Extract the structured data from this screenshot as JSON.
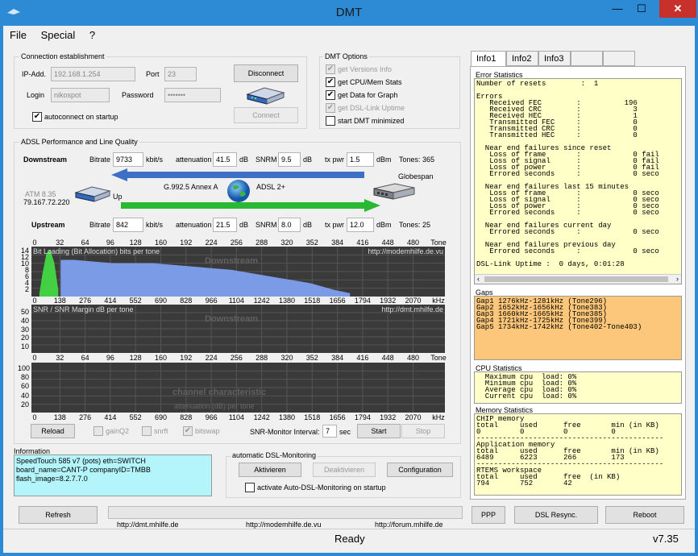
{
  "window": {
    "title": "DMT",
    "minimize": "—",
    "maximize": "☐",
    "close": "✕"
  },
  "menu": [
    "File",
    "Special",
    "?"
  ],
  "connection": {
    "group_label": "Connection establishment",
    "ip_label": "IP-Add.",
    "ip_value": "192.168.1.254",
    "port_label": "Port",
    "port_value": "23",
    "login_label": "Login",
    "login_value": "nikospot",
    "password_label": "Password",
    "password_value": "•••••••",
    "autoconnect_label": "autoconnect on startup",
    "disconnect_label": "Disconnect",
    "connect_label": "Connect"
  },
  "dmt_options": {
    "group_label": "DMT Options",
    "items": [
      {
        "label": "get Versions Info",
        "checked": true,
        "enabled": false
      },
      {
        "label": "get CPU/Mem Stats",
        "checked": true,
        "enabled": true
      },
      {
        "label": "get Data for Graph",
        "checked": true,
        "enabled": true
      },
      {
        "label": "get DSL-Link Uptime",
        "checked": true,
        "enabled": false
      },
      {
        "label": "start DMT minimized",
        "checked": false,
        "enabled": true
      }
    ]
  },
  "adsl": {
    "group_label": "ADSL Performance and Line Quality",
    "downstream": {
      "label": "Downstream",
      "bitrate_label": "Bitrate",
      "bitrate": "9733",
      "bitrate_unit": "kbit/s",
      "att_label": "attenuation",
      "att": "41.5",
      "att_unit": "dB",
      "snrm_label": "SNRM",
      "snrm": "9.5",
      "snrm_unit": "dB",
      "txpwr_label": "tx pwr",
      "txpwr": "1.5",
      "txpwr_unit": "dBm",
      "tones": "Tones: 365"
    },
    "upstream": {
      "label": "Upstream",
      "bitrate_label": "Bitrate",
      "bitrate": "842",
      "bitrate_unit": "kbit/s",
      "att_label": "attenuation",
      "att": "21.5",
      "att_unit": "dB",
      "snrm_label": "SNRM",
      "snrm": "8.0",
      "snrm_unit": "dB",
      "txpwr_label": "tx pwr",
      "txpwr": "12.0",
      "txpwr_unit": "dBm",
      "tones": "Tones: 25"
    },
    "atm": "ATM 8.35",
    "ext_ip": "79.167.72.220",
    "up_label": "Up",
    "mode": "G.992.5 Annex A",
    "adsl_type": "ADSL 2+",
    "dslam": "Globespan"
  },
  "charts": {
    "top_axis": [
      "0",
      "32",
      "64",
      "96",
      "128",
      "160",
      "192",
      "224",
      "256",
      "288",
      "320",
      "352",
      "384",
      "416",
      "448",
      "480",
      "Tone"
    ],
    "bottom_axis": [
      "0",
      "138",
      "276",
      "414",
      "552",
      "690",
      "828",
      "966",
      "1104",
      "1242",
      "1380",
      "1518",
      "1656",
      "1794",
      "1932",
      "2070",
      "kHz"
    ],
    "bitload": {
      "title": "Bit Loading (Bit Allocation)   bits per tone",
      "url": "http://modemhilfe.de.vu",
      "wm": "Downstream",
      "yticks": [
        "14",
        "12",
        "10",
        "8",
        "6",
        "4",
        "2"
      ]
    },
    "snr": {
      "title": "SNR / SNR Margin  dB per tone",
      "url": "http://dmt.mhilfe.de",
      "wm": "Downstream",
      "yticks": [
        "50",
        "40",
        "30",
        "20",
        "10"
      ]
    },
    "chan": {
      "wm1": "channel characteristic",
      "wm2": "attenuation (dB) per tone",
      "yticks": [
        "100",
        "80",
        "60",
        "40",
        "20"
      ]
    }
  },
  "chart_data": [
    {
      "type": "area",
      "title": "Bit Loading (Bit Allocation)   bits per tone",
      "xlabel": "Tone",
      "ylim": [
        0,
        15
      ],
      "series": [
        {
          "name": "Up",
          "x": [
            6,
            10,
            15,
            20,
            25,
            30
          ],
          "values": [
            1,
            7,
            13,
            14,
            10,
            2
          ]
        },
        {
          "name": "Downstream",
          "x": [
            33,
            50,
            100,
            150,
            200,
            250,
            300,
            350,
            380,
            400
          ],
          "values": [
            11,
            11,
            10,
            10,
            9,
            8,
            6,
            4,
            2,
            1
          ]
        }
      ]
    },
    {
      "type": "area",
      "title": "SNR / SNR Margin  dB per tone",
      "ylim": [
        0,
        55
      ],
      "series": []
    },
    {
      "type": "area",
      "title": "channel characteristic",
      "ylim": [
        0,
        110
      ],
      "series": []
    }
  ],
  "controls": {
    "reload": "Reload",
    "gainq2": "gainQ2",
    "snrft": "snrft",
    "bitswap": "bitswap",
    "snr_interval_label": "SNR-Monitor Interval:",
    "snr_interval": "7",
    "snr_interval_unit": "sec",
    "start": "Start",
    "stop": "Stop"
  },
  "information": {
    "label": "Information",
    "lines": [
      "SpeedTouch 585 v7 (pots) eth=SWITCH",
      "board_name=CANT-P   companyID=TMBB",
      "flash_image=8.2.7.7.0"
    ]
  },
  "auto_monitor": {
    "label": "automatic DSL-Monitoring",
    "activate": "Aktivieren",
    "deactivate": "Deaktivieren",
    "config": "Configuration",
    "startup_label": "activate Auto-DSL-Monitoring on startup"
  },
  "bottom": {
    "refresh": "Refresh",
    "link1": "http://dmt.mhilfe.de",
    "link2": "http://modemhilfe.de.vu",
    "link3": "http://forum.mhilfe.de",
    "ppp": "PPP",
    "resync": "DSL Resync.",
    "reboot": "Reboot",
    "status": "Ready",
    "version": "v7.35"
  },
  "tabs": [
    "Info1",
    "Info2",
    "Info3",
    "",
    ""
  ],
  "error_stats": {
    "label": "Error Statistics",
    "text": "Number of resets        :  1\n\nErrors\n   Received FEC        :          196\n   Received CRC        :            3\n   Received HEC        :            1\n   Transmitted FEC     :            0\n   Transmitted CRC     :            0\n   Transmitted HEC     :            0\n\n  Near end failures since reset\n   Loss of frame       :            0 fail\n   Loss of signal      :            0 fail\n   Loss of power       :            0 fail\n   Errored seconds     :            0 seco\n\n  Near end failures last 15 minutes\n   Loss of frame       :            0 seco\n   Loss of signal      :            0 seco\n   Loss of power       :            0 seco\n   Errored seconds     :            0 seco\n\n  Near end failures current day\n   Errored seconds     :            0 seco\n\n  Near end failures previous day\n   Errored seconds     :            0 seco\n\nDSL-Link Uptime :  0 days, 0:01:28"
  },
  "gaps": {
    "label": "Gaps",
    "text": "Gap1 1276kHz-1281kHz (Tone296)\nGap2 1652kHz-1656kHz (Tone383)\nGap3 1660kHz-1665kHz (Tone385)\nGap4 1721kHz-1725kHz (Tone399)\nGap5 1734kHz-1742kHz (Tone402-Tone403)"
  },
  "cpu": {
    "label": "CPU Statistics",
    "text": "  Maximum cpu  load: 0%\n  Minimum cpu  load: 0%\n  Average cpu  load: 0%\n  Current cpu  load: 0%"
  },
  "memory": {
    "label": "Memory Statistics",
    "text": "CHIP memory\ntotal     used      free       min (in KB)\n0         0         0          0\n-------------------------------------------\nApplication memory\ntotal     used      free       min (in KB)\n6489      6223      266        173\n-------------------------------------------\nRTEMS workspace\ntotal     used      free  (in KB)\n794       752       42"
  }
}
